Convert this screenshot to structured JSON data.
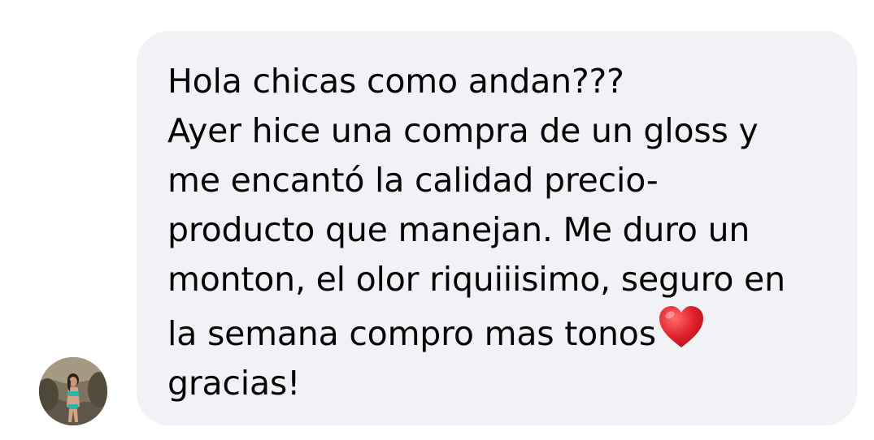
{
  "message": {
    "lines": [
      "Hola chicas como andan???",
      "Ayer hice una compra de un gloss y",
      "me encantó la calidad precio-",
      "producto que manejan. Me duro un",
      "monton, el olor riquiiisimo, seguro en",
      "la semana compro mas tonos",
      "gracias!"
    ],
    "heart_emoji": "red-heart-icon"
  },
  "colors": {
    "bubble_background": "#f0f2f5",
    "text": "#050505",
    "heart": "#e0202c"
  }
}
